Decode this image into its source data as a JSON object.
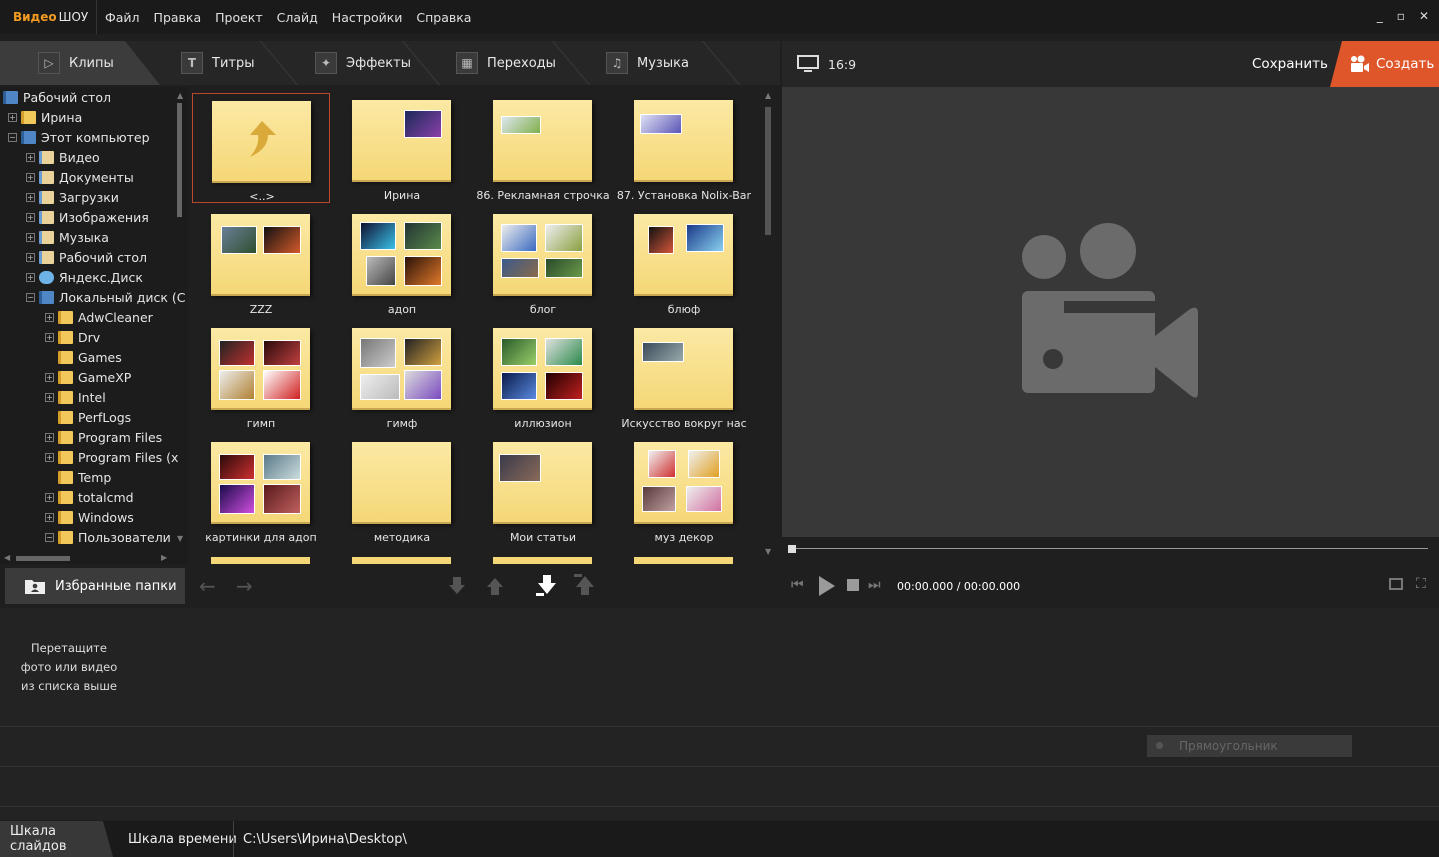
{
  "app": {
    "logo_part1": "Видео",
    "logo_part2": "ШОУ"
  },
  "menu": [
    "Файл",
    "Правка",
    "Проект",
    "Слайд",
    "Настройки",
    "Справка"
  ],
  "window_controls": [
    "_",
    "▫",
    "✕"
  ],
  "tabs": [
    {
      "label": "Клипы",
      "icon": "play-icon"
    },
    {
      "label": "Титры",
      "icon": "text-t-icon"
    },
    {
      "label": "Эффекты",
      "icon": "magic-wand-icon"
    },
    {
      "label": "Переходы",
      "icon": "clapper-icon"
    },
    {
      "label": "Музыка",
      "icon": "music-note-icon"
    }
  ],
  "preview_header": {
    "ratio": "16:9",
    "save": "Сохранить",
    "create": "Создать"
  },
  "tree": [
    {
      "label": "Рабочий стол",
      "level": 0,
      "expander": "",
      "icon": "pc"
    },
    {
      "label": "Ирина",
      "level": 1,
      "expander": "+",
      "icon": "user"
    },
    {
      "label": "Этот компьютер",
      "level": 1,
      "expander": "−",
      "icon": "pc"
    },
    {
      "label": "Видео",
      "level": 2,
      "expander": "+",
      "icon": "sys"
    },
    {
      "label": "Документы",
      "level": 2,
      "expander": "+",
      "icon": "sys"
    },
    {
      "label": "Загрузки",
      "level": 2,
      "expander": "+",
      "icon": "sys"
    },
    {
      "label": "Изображения",
      "level": 2,
      "expander": "+",
      "icon": "sys"
    },
    {
      "label": "Музыка",
      "level": 2,
      "expander": "+",
      "icon": "sys"
    },
    {
      "label": "Рабочий стол",
      "level": 2,
      "expander": "+",
      "icon": "sys"
    },
    {
      "label": "Яндекс.Диск",
      "level": 2,
      "expander": "+",
      "icon": "cloud"
    },
    {
      "label": "Локальный диск (С",
      "level": 2,
      "expander": "−",
      "icon": "pc"
    },
    {
      "label": "AdwCleaner",
      "level": 3,
      "expander": "+",
      "icon": "folder"
    },
    {
      "label": "Drv",
      "level": 3,
      "expander": "+",
      "icon": "folder"
    },
    {
      "label": "Games",
      "level": 3,
      "expander": "",
      "icon": "folder"
    },
    {
      "label": "GameXP",
      "level": 3,
      "expander": "+",
      "icon": "folder"
    },
    {
      "label": "Intel",
      "level": 3,
      "expander": "+",
      "icon": "folder"
    },
    {
      "label": "PerfLogs",
      "level": 3,
      "expander": "",
      "icon": "folder"
    },
    {
      "label": "Program Files",
      "level": 3,
      "expander": "+",
      "icon": "folder"
    },
    {
      "label": "Program Files (x",
      "level": 3,
      "expander": "+",
      "icon": "folder"
    },
    {
      "label": "Temp",
      "level": 3,
      "expander": "",
      "icon": "folder"
    },
    {
      "label": "totalcmd",
      "level": 3,
      "expander": "+",
      "icon": "folder"
    },
    {
      "label": "Windows",
      "level": 3,
      "expander": "+",
      "icon": "folder"
    },
    {
      "label": "Пользователи",
      "level": 3,
      "expander": "−",
      "icon": "folder"
    }
  ],
  "folders": [
    {
      "label": "<..>",
      "kind": "up",
      "selected": true
    },
    {
      "label": "Ирина",
      "kind": "t1"
    },
    {
      "label": "86. Рекламная строчка",
      "kind": "t2"
    },
    {
      "label": "87. Установка Nolix-Bar",
      "kind": "t3"
    },
    {
      "label": "ZZZ",
      "kind": "t4"
    },
    {
      "label": "адоп",
      "kind": "t5"
    },
    {
      "label": "блог",
      "kind": "t6"
    },
    {
      "label": "блюф",
      "kind": "t7"
    },
    {
      "label": "гимп",
      "kind": "t8"
    },
    {
      "label": "гимф",
      "kind": "t9"
    },
    {
      "label": "иллюзион",
      "kind": "t10"
    },
    {
      "label": "Искусство вокруг нас",
      "kind": "t11"
    },
    {
      "label": "картинки для адоп",
      "kind": "t12"
    },
    {
      "label": "методика",
      "kind": "empty"
    },
    {
      "label": "Мои статьи",
      "kind": "t13"
    },
    {
      "label": "муз декор",
      "kind": "t14"
    }
  ],
  "toolbar": {
    "favorites": "Избранные папки"
  },
  "player": {
    "timecode": "00:00.000 / 00:00.000"
  },
  "story": {
    "hint_line1": "Перетащите",
    "hint_line2": "фото или видео",
    "hint_line3": "из списка выше",
    "rect_label": "Прямоугольник"
  },
  "statusbar": {
    "tab1": "Шкала слайдов",
    "tab2": "Шкала времени",
    "path": "C:\\Users\\Ирина\\Desktop\\"
  },
  "colors": {
    "accent": "#e0562b",
    "logo": "#f29b1f",
    "folder": "#f7dc84"
  }
}
